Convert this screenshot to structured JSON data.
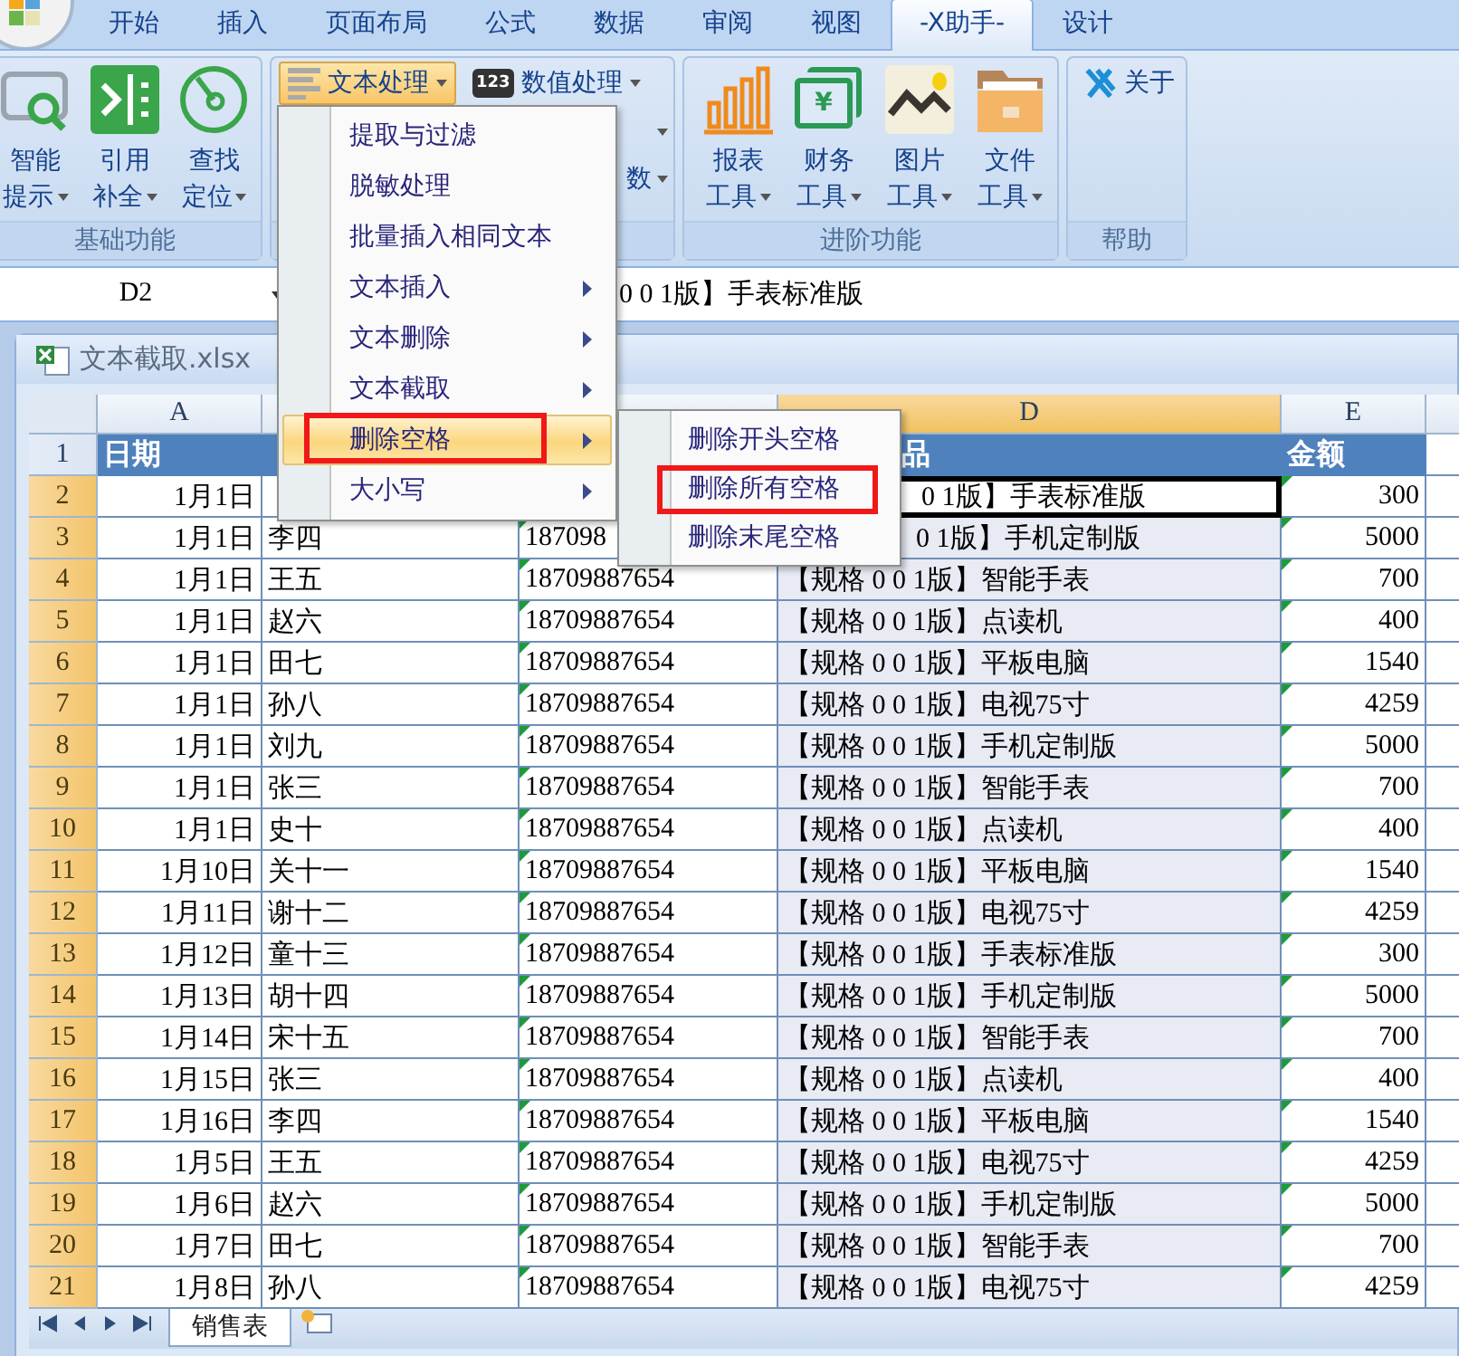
{
  "ribbon_tabs": [
    {
      "label": "开始",
      "selected": false
    },
    {
      "label": "插入",
      "selected": false
    },
    {
      "label": "页面布局",
      "selected": false
    },
    {
      "label": "公式",
      "selected": false
    },
    {
      "label": "数据",
      "selected": false
    },
    {
      "label": "审阅",
      "selected": false
    },
    {
      "label": "视图",
      "selected": false
    },
    {
      "label": "-X助手-",
      "selected": true
    },
    {
      "label": "设计",
      "selected": false
    }
  ],
  "ribbon_groups": [
    {
      "label": "基础功能",
      "kind": "large",
      "buttons": [
        {
          "lines": [
            "智能",
            "提示"
          ],
          "dropdown": true
        },
        {
          "lines": [
            "引用",
            "补全"
          ],
          "dropdown": true
        },
        {
          "lines": [
            "查找",
            "定位"
          ],
          "dropdown": true
        }
      ]
    },
    {
      "kind": "small",
      "buttons": [
        {
          "label": "文本处理",
          "dropdown": true,
          "selected": true
        },
        {
          "label": "数值处理",
          "icon_text": "123",
          "dropdown": true,
          "selected": false
        }
      ],
      "partial_buttons": [
        {
          "dropdown": true
        },
        {
          "label": "数",
          "dropdown": true
        }
      ]
    },
    {
      "label": "进阶功能",
      "kind": "large",
      "buttons": [
        {
          "lines": [
            "报表",
            "工具"
          ],
          "dropdown": true
        },
        {
          "lines": [
            "财务",
            "工具"
          ],
          "icon_text": "¥",
          "dropdown": true
        },
        {
          "lines": [
            "图片",
            "工具"
          ],
          "dropdown": true
        },
        {
          "lines": [
            "文件",
            "工具"
          ],
          "dropdown": true
        }
      ]
    },
    {
      "label": "帮助",
      "kind": "small",
      "buttons": [
        {
          "label": "关于",
          "dropdown": false,
          "selected": false
        }
      ]
    }
  ],
  "formula_bar": {
    "name_box": "D2",
    "formula": "0 0 1版】手表标准版"
  },
  "workbook": {
    "title": "文本截取.xlsx"
  },
  "sheet": {
    "columns": [
      {
        "label": "A",
        "selected": false
      },
      {
        "selected": false
      },
      {
        "selected": false,
        "flagged": true
      },
      {
        "label": "D",
        "selected": true
      },
      {
        "label": "E",
        "selected": false,
        "flagged": true
      }
    ],
    "header_row": {
      "number": "1",
      "selected": false,
      "cells": [
        "日期",
        null,
        null,
        {
          "text": "品",
          "cut_start": true
        },
        "金额"
      ]
    },
    "rows": [
      {
        "number": "2",
        "selected": true,
        "active": true,
        "cells": [
          "1月1日",
          null,
          null,
          {
            "text": "0 1版】手表标准版",
            "cut_start": true
          },
          "300"
        ]
      },
      {
        "number": "3",
        "selected": true,
        "active": false,
        "cells": [
          "1月1日",
          "李四",
          "187098",
          {
            "text": "0 1版】手机定制版",
            "cut_start": true
          },
          "5000"
        ]
      },
      {
        "number": "4",
        "selected": true,
        "active": false,
        "cells": [
          "1月1日",
          "王五",
          "18709887654",
          "【规格 0 0 1版】智能手表",
          "700"
        ]
      },
      {
        "number": "5",
        "selected": true,
        "active": false,
        "cells": [
          "1月1日",
          "赵六",
          "18709887654",
          "【规格 0 0 1版】点读机",
          "400"
        ]
      },
      {
        "number": "6",
        "selected": true,
        "active": false,
        "cells": [
          "1月1日",
          "田七",
          "18709887654",
          "【规格 0 0 1版】平板电脑",
          "1540"
        ]
      },
      {
        "number": "7",
        "selected": true,
        "active": false,
        "cells": [
          "1月1日",
          "孙八",
          "18709887654",
          "【规格 0 0 1版】电视75寸",
          "4259"
        ]
      },
      {
        "number": "8",
        "selected": true,
        "active": false,
        "cells": [
          "1月1日",
          "刘九",
          "18709887654",
          "【规格 0 0 1版】手机定制版",
          "5000"
        ]
      },
      {
        "number": "9",
        "selected": true,
        "active": false,
        "cells": [
          "1月1日",
          "张三",
          "18709887654",
          "【规格 0 0 1版】智能手表",
          "700"
        ]
      },
      {
        "number": "10",
        "selected": true,
        "active": false,
        "cells": [
          "1月1日",
          "史十",
          "18709887654",
          "【规格 0 0 1版】点读机",
          "400"
        ]
      },
      {
        "number": "11",
        "selected": true,
        "active": false,
        "cells": [
          "1月10日",
          "关十一",
          "18709887654",
          "【规格 0 0 1版】平板电脑",
          "1540"
        ]
      },
      {
        "number": "12",
        "selected": true,
        "active": false,
        "cells": [
          "1月11日",
          "谢十二",
          "18709887654",
          "【规格 0 0 1版】电视75寸",
          "4259"
        ]
      },
      {
        "number": "13",
        "selected": true,
        "active": false,
        "cells": [
          "1月12日",
          "童十三",
          "18709887654",
          "【规格 0 0 1版】手表标准版",
          "300"
        ]
      },
      {
        "number": "14",
        "selected": true,
        "active": false,
        "cells": [
          "1月13日",
          "胡十四",
          "18709887654",
          "【规格 0 0 1版】手机定制版",
          "5000"
        ]
      },
      {
        "number": "15",
        "selected": true,
        "active": false,
        "cells": [
          "1月14日",
          "宋十五",
          "18709887654",
          "【规格 0 0 1版】智能手表",
          "700"
        ]
      },
      {
        "number": "16",
        "selected": true,
        "active": false,
        "cells": [
          "1月15日",
          "张三",
          "18709887654",
          "【规格 0 0 1版】点读机",
          "400"
        ]
      },
      {
        "number": "17",
        "selected": true,
        "active": false,
        "cells": [
          "1月16日",
          "李四",
          "18709887654",
          "【规格 0 0 1版】平板电脑",
          "1540"
        ]
      },
      {
        "number": "18",
        "selected": true,
        "active": false,
        "cells": [
          "1月5日",
          "王五",
          "18709887654",
          "【规格 0 0 1版】电视75寸",
          "4259"
        ]
      },
      {
        "number": "19",
        "selected": true,
        "active": false,
        "cells": [
          "1月6日",
          "赵六",
          "18709887654",
          "【规格 0 0 1版】手机定制版",
          "5000"
        ]
      },
      {
        "number": "20",
        "selected": true,
        "active": false,
        "cells": [
          "1月7日",
          "田七",
          "18709887654",
          "【规格 0 0 1版】智能手表",
          "700"
        ]
      },
      {
        "number": "21",
        "selected": true,
        "active": false,
        "cells": [
          "1月8日",
          "孙八",
          "18709887654",
          "【规格 0 0 1版】电视75寸",
          "4259"
        ]
      }
    ]
  },
  "sheet_tabs": [
    {
      "label": "销售表",
      "selected": true
    }
  ],
  "menu": {
    "items": [
      {
        "label": "提取与过滤",
        "submenu": false,
        "selected": false,
        "annotated": false
      },
      {
        "label": "脱敏处理",
        "submenu": false,
        "selected": false,
        "annotated": false
      },
      {
        "label": "批量插入相同文本",
        "submenu": false,
        "selected": false,
        "annotated": false
      },
      {
        "label": "文本插入",
        "submenu": true,
        "selected": false,
        "annotated": false
      },
      {
        "label": "文本删除",
        "submenu": true,
        "selected": false,
        "annotated": false
      },
      {
        "label": "文本截取",
        "submenu": true,
        "selected": false,
        "annotated": false
      },
      {
        "label": "删除空格",
        "submenu": true,
        "selected": true,
        "annotated": true
      },
      {
        "label": "大小写",
        "submenu": true,
        "selected": false,
        "annotated": false
      }
    ]
  },
  "submenu": {
    "items": [
      {
        "label": "删除开头空格",
        "annotated": false
      },
      {
        "label": "删除所有空格",
        "annotated": true
      },
      {
        "label": "删除末尾空格",
        "annotated": false
      }
    ]
  }
}
